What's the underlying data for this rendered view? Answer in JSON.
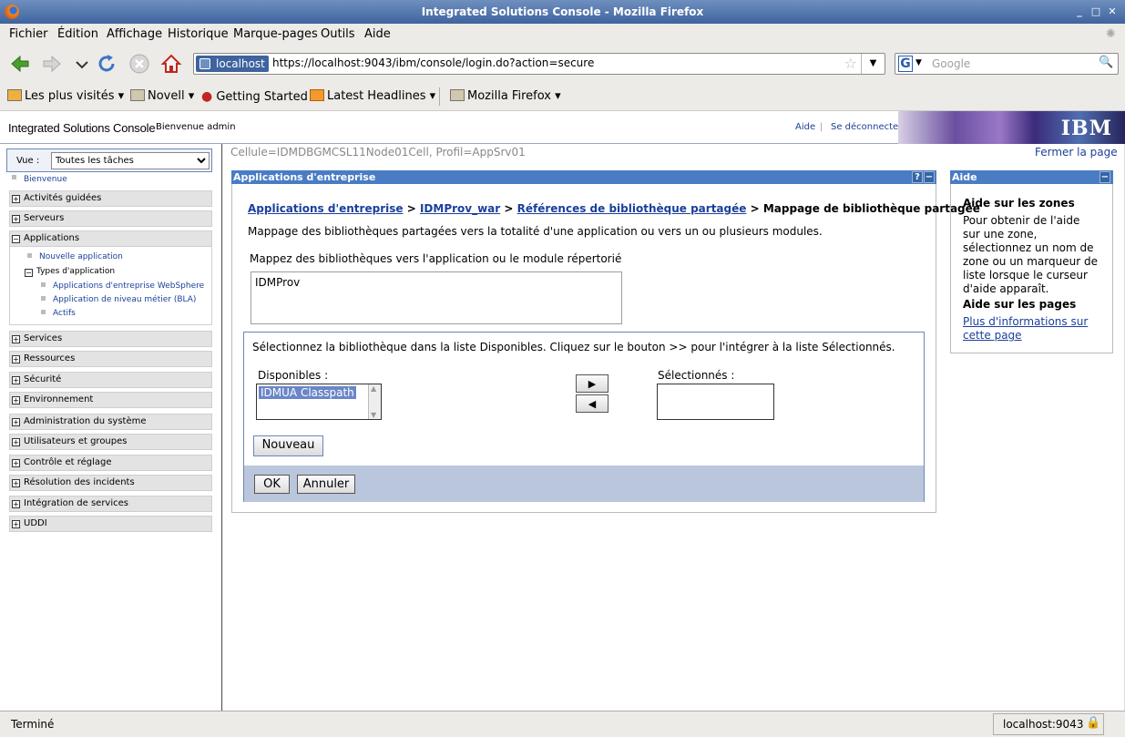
{
  "window": {
    "title": "Integrated Solutions Console - Mozilla Firefox"
  },
  "menu": [
    "Fichier",
    "Édition",
    "Affichage",
    "Historique",
    "Marque-pages",
    "Outils",
    "Aide"
  ],
  "nav": {
    "site_label": "localhost",
    "url": "https://localhost:9043/ibm/console/login.do?action=secure",
    "search_placeholder": "Google"
  },
  "bookmarks": [
    "Les plus visités",
    "Novell",
    "Getting Started",
    "Latest Headlines",
    "Mozilla Firefox"
  ],
  "console_header": {
    "title": "Integrated Solutions Console",
    "welcome": "Bienvenue admin",
    "help_link": "Aide",
    "separator": "|",
    "logout_link": "Se déconnecter",
    "logo": "IBM"
  },
  "sidebar": {
    "view_label": "Vue :",
    "view_value": "Toutes les tâches",
    "welcome": "Bienvenue",
    "items": [
      {
        "label": "Activités guidées",
        "sign": "+"
      },
      {
        "label": "Serveurs",
        "sign": "+"
      },
      {
        "label": "Applications",
        "sign": "−"
      },
      {
        "label": "Services",
        "sign": "+"
      },
      {
        "label": "Ressources",
        "sign": "+"
      },
      {
        "label": "Sécurité",
        "sign": "+"
      },
      {
        "label": "Environnement",
        "sign": "+"
      },
      {
        "label": "Administration du système",
        "sign": "+"
      },
      {
        "label": "Utilisateurs et groupes",
        "sign": "+"
      },
      {
        "label": "Contrôle et réglage",
        "sign": "+"
      },
      {
        "label": "Résolution des incidents",
        "sign": "+"
      },
      {
        "label": "Intégration de services",
        "sign": "+"
      },
      {
        "label": "UDDI",
        "sign": "+"
      }
    ],
    "applications_sub": {
      "new_app": "Nouvelle application",
      "types": "Types d'application",
      "types_sign": "−",
      "websphere": "Applications d'entreprise WebSphere",
      "bla": "Application de niveau métier (BLA)",
      "assets": "Actifs"
    }
  },
  "main": {
    "cell_info": "Cellule=IDMDBGMCSL11Node01Cell, Profil=AppSrv01",
    "close_page": "Fermer la page",
    "panel_title": "Applications d'entreprise",
    "panel_help": "?",
    "panel_min": "−",
    "breadcrumb": {
      "b1": "Applications d'entreprise",
      "sep": ">",
      "b2": "IDMProv_war",
      "b3": "Références de bibliothèque partagée",
      "current": "Mappage de bibliothèque partagée"
    },
    "description": "Mappage des bibliothèques partagées vers la totalité d'une application ou vers un ou plusieurs modules.",
    "map_label": "Mappez des bibliothèques vers l'application ou le module répertorié",
    "module_list": [
      "IDMProv"
    ],
    "select_instruction": "Sélectionnez la bibliothèque dans la liste Disponibles. Cliquez sur le bouton >> pour l'intégrer à la liste Sélectionnés.",
    "available_label": "Disponibles :",
    "available_items": [
      "IDMUA Classpath"
    ],
    "selected_label": "Sélectionnés :",
    "new_button": "Nouveau",
    "ok_button": "OK",
    "cancel_button": "Annuler"
  },
  "help_panel": {
    "title": "Aide",
    "min": "−",
    "fields_heading": "Aide sur les zones",
    "fields_text": "Pour obtenir de l'aide sur une zone, sélectionnez un nom de zone ou un marqueur de liste lorsque le curseur d'aide apparaît.",
    "pages_heading": "Aide sur les pages",
    "pages_link": "Plus d'informations sur cette page"
  },
  "status": {
    "left": "Terminé",
    "right": "localhost:9043"
  },
  "colors": {
    "panel_header": "#4a7cc4",
    "link": "#1b3f9b",
    "button_bar": "#b9c6dc"
  }
}
